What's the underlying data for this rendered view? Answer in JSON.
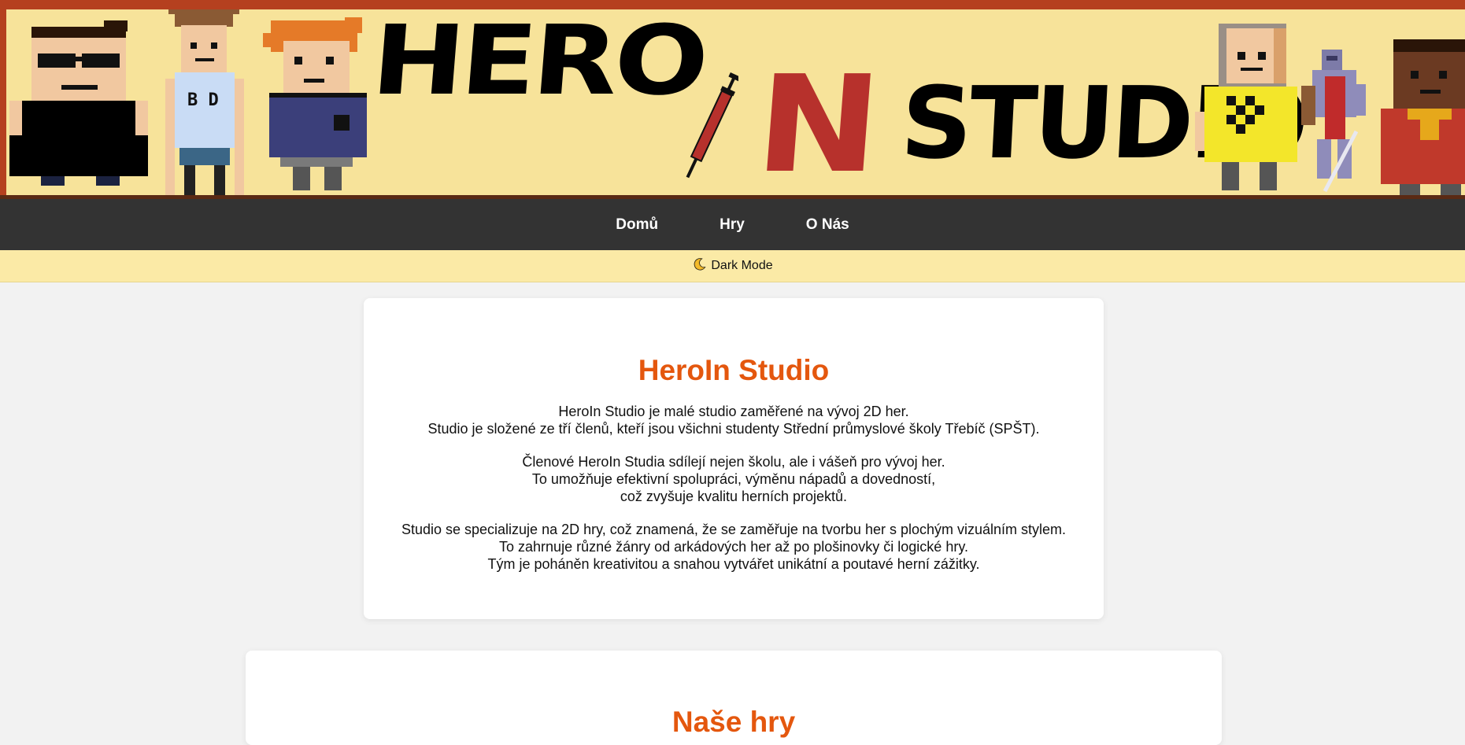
{
  "banner": {
    "logo_part1": "HERO",
    "logo_part2": "N",
    "logo_part3": "STUDIO"
  },
  "nav": {
    "items": [
      {
        "label": "Domů"
      },
      {
        "label": "Hry"
      },
      {
        "label": "O Nás"
      }
    ]
  },
  "theme_toggle": {
    "icon": "moon-icon",
    "label": "Dark Mode"
  },
  "about": {
    "title": "HeroIn Studio",
    "p1_l1": "HeroIn Studio je malé studio zaměřené na vývoj 2D her.",
    "p1_l2": "Studio je složené ze tří členů, kteří jsou všichni studenty Střední průmyslové školy Třebíč (SPŠT).",
    "p2_l1": "Členové HeroIn Studia sdílejí nejen školu, ale i vášeň pro vývoj her.",
    "p2_l2": "To umožňuje efektivní spolupráci, výměnu nápadů a dovedností,",
    "p2_l3": "což zvyšuje kvalitu herních projektů.",
    "p3_l1": "Studio se specializuje na 2D hry, což znamená, že se zaměřuje na tvorbu her s plochým vizuálním stylem.",
    "p3_l2": "To zahrnuje různé žánry od arkádových her až po plošinovky či logické hry.",
    "p3_l3": "Tým je poháněn kreativitou a snahou vytvářet unikátní a poutavé herní zážitky."
  },
  "section2": {
    "title": "Naše hry"
  },
  "colors": {
    "accent": "#e4570e",
    "nav_bg": "#333333",
    "banner_bg": "#f7e39a",
    "banner_frame": "#b5401f",
    "theme_bar_bg": "#fbeaa6"
  }
}
